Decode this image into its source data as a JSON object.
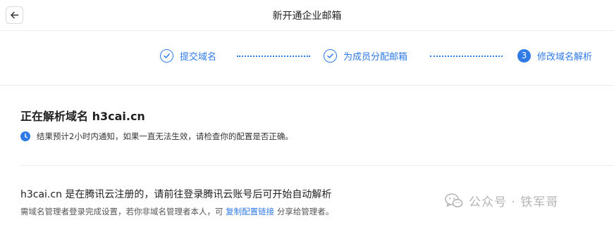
{
  "header": {
    "title": "新开通企业邮箱"
  },
  "steps": [
    {
      "label": "提交域名",
      "status": "done"
    },
    {
      "label": "为成员分配邮箱",
      "status": "done"
    },
    {
      "label": "修改域名解析",
      "status": "current",
      "number": "3"
    }
  ],
  "section": {
    "title": "正在解析域名 h3cai.cn",
    "notice": "结果预计2小时内通知，如果一直无法生效，请检查你的配置是否正确。"
  },
  "info": {
    "main": "h3cai.cn 是在腾讯云注册的，请前往登录腾讯云账号后可开始自动解析",
    "sub_prefix": "需域名管理者登录完成设置，若你非域名管理者本人，可",
    "copy_link": "复制配置链接",
    "sub_suffix": "分享给管理者。"
  },
  "watermark": {
    "text": "公众号 · 铁军哥"
  },
  "colors": {
    "accent": "#2f7ae5"
  },
  "icons": {
    "back": "arrow-left-icon",
    "done": "check-circle-icon",
    "notice": "clock-icon",
    "watermark": "wechat-icon"
  }
}
